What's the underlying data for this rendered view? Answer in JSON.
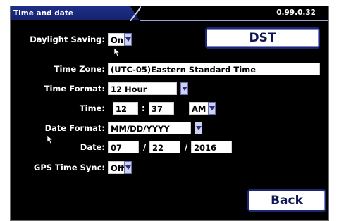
{
  "header": {
    "title": "Time and date",
    "version": "0.99.0.32"
  },
  "daylight_saving": {
    "label": "Daylight Saving:",
    "value": "On"
  },
  "dst_button": {
    "label": "DST"
  },
  "time_zone": {
    "label": "Time Zone:",
    "value": "(UTC-05)Eastern Standard Time"
  },
  "time_format": {
    "label": "Time Format:",
    "value": "12 Hour"
  },
  "time": {
    "label": "Time:",
    "hour": "12",
    "separator": ":",
    "minute": "37",
    "ampm": "AM"
  },
  "date_format": {
    "label": "Date Format:",
    "value": "MM/DD/YYYY"
  },
  "date": {
    "label": "Date:",
    "month": "07",
    "separator1": "/",
    "day": "22",
    "separator2": "/",
    "year": "2016"
  },
  "gps_sync": {
    "label": "GPS Time Sync:",
    "value": "Off"
  },
  "back_button": {
    "label": "Back"
  },
  "colors": {
    "header": "#1f2f8a",
    "background": "#000000",
    "dropdown": "#cfd2ee",
    "button_border": "#1c2674"
  },
  "icons": [
    "dropdown-arrow-icon",
    "mouse-pointer-icon"
  ]
}
